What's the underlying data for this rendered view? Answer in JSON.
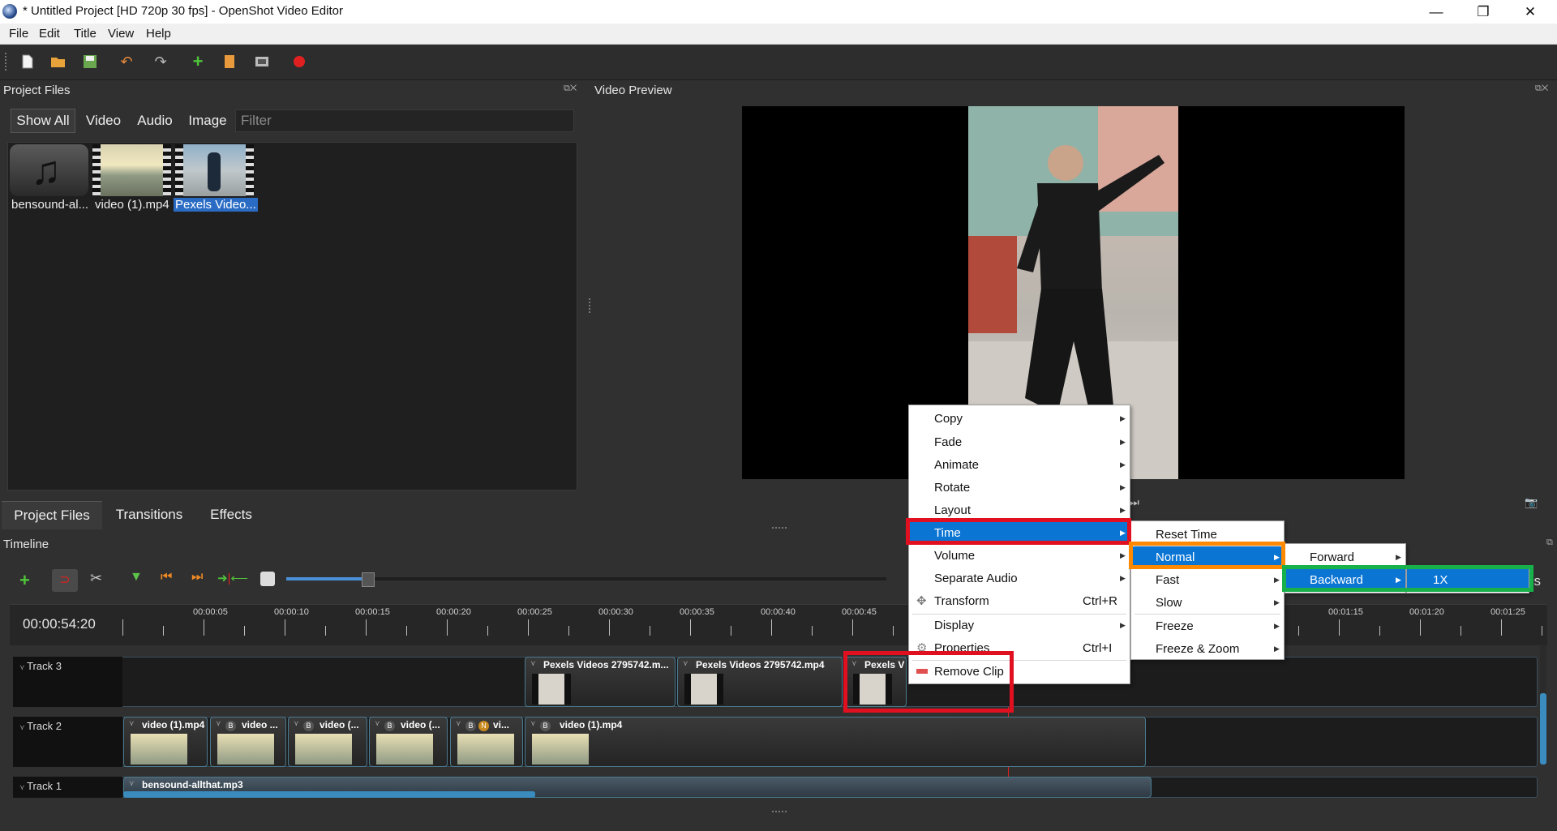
{
  "window": {
    "title": "* Untitled Project [HD 720p 30 fps] - OpenShot Video Editor",
    "minimize": "—",
    "maximize": "❐",
    "close": "✕"
  },
  "menubar": [
    "File",
    "Edit",
    "Title",
    "View",
    "Help"
  ],
  "toolbar_icons": [
    "new-project-icon",
    "open-project-icon",
    "save-project-icon",
    "undo-icon",
    "redo-icon",
    "import-files-icon",
    "profile-icon",
    "fullscreen-icon",
    "export-video-icon"
  ],
  "project_files": {
    "title": "Project Files",
    "filters": [
      "Show All",
      "Video",
      "Audio",
      "Image"
    ],
    "filter_placeholder": "Filter",
    "files": [
      {
        "name": "bensound-al..."
      },
      {
        "name": "video (1).mp4"
      },
      {
        "name": "Pexels Video..."
      }
    ],
    "bottom_tabs": [
      "Project Files",
      "Transitions",
      "Effects"
    ]
  },
  "video_preview": {
    "title": "Video Preview"
  },
  "timeline": {
    "title": "Timeline",
    "current_time": "00:00:54:20",
    "ticks": [
      "00:00:05",
      "00:00:10",
      "00:00:15",
      "00:00:20",
      "00:00:25",
      "00:00:30",
      "00:00:35",
      "00:00:40",
      "00:00:45",
      "00:01:15",
      "00:01:20",
      "00:01:25"
    ],
    "zoom_level": 0.7,
    "seconds_label": "ds",
    "tracks": [
      {
        "name": "Track 3",
        "clips": [
          "Pexels Videos 2795742.m...",
          "Pexels Videos 2795742.mp4",
          "Pexels V"
        ]
      },
      {
        "name": "Track 2",
        "clips": [
          "video (1).mp4",
          "video ...",
          "video (...",
          "video (...",
          "vi...",
          "video (1).mp4"
        ]
      },
      {
        "name": "Track 1",
        "clips": [
          "bensound-allthat.mp3"
        ]
      }
    ],
    "clip_badges": {
      "b": "B",
      "n": "N"
    }
  },
  "context_menu": {
    "items": [
      {
        "label": "Copy",
        "submenu": true
      },
      {
        "label": "Fade",
        "submenu": true
      },
      {
        "label": "Animate",
        "submenu": true
      },
      {
        "label": "Rotate",
        "submenu": true
      },
      {
        "label": "Layout",
        "submenu": true
      },
      {
        "label": "Time",
        "submenu": true,
        "selected": true
      },
      {
        "label": "Volume",
        "submenu": true
      },
      {
        "label": "Separate Audio",
        "submenu": true
      },
      {
        "label": "Transform",
        "shortcut": "Ctrl+R"
      },
      {
        "label": "Display",
        "submenu": true
      },
      {
        "label": "Properties",
        "shortcut": "Ctrl+I"
      },
      {
        "label": "Remove Clip"
      }
    ]
  },
  "time_submenu": {
    "items": [
      {
        "label": "Reset Time"
      },
      {
        "label": "Normal",
        "submenu": true,
        "selected": true
      },
      {
        "label": "Fast",
        "submenu": true
      },
      {
        "label": "Slow",
        "submenu": true
      },
      {
        "label": "Freeze",
        "submenu": true
      },
      {
        "label": "Freeze & Zoom",
        "submenu": true
      }
    ]
  },
  "normal_submenu": {
    "items": [
      {
        "label": "Forward",
        "submenu": true
      },
      {
        "label": "Backward",
        "submenu": true,
        "selected": true
      }
    ]
  },
  "backward_submenu": {
    "items": [
      {
        "label": "1X",
        "selected": true
      }
    ]
  },
  "annotation_colors": {
    "red": "#e01020",
    "orange": "#ff8a00",
    "green": "#18b04a",
    "select": "#0b75d4"
  }
}
